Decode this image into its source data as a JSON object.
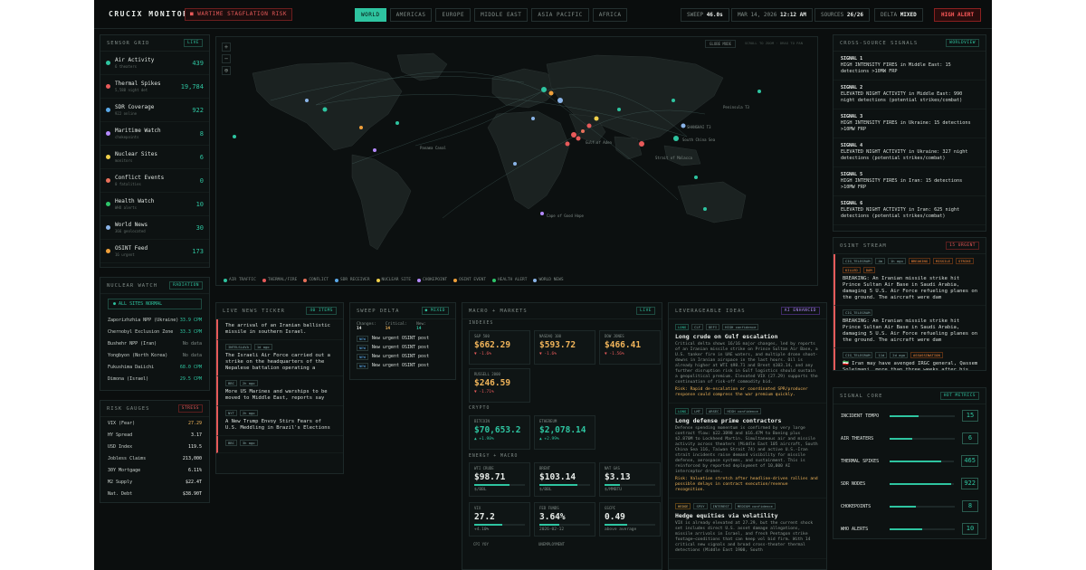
{
  "header": {
    "logo": "CRUCIX MONITOR",
    "alert": "WARTIME STAGFLATION RISK",
    "tabs": [
      "WORLD",
      "AMERICAS",
      "EUROPE",
      "MIDDLE EAST",
      "ASIA PACIFIC",
      "AFRICA"
    ],
    "sweep_label": "SWEEP",
    "sweep_value": "46.0s",
    "date": "MAR 14, 2026",
    "time": "12:12 AM",
    "sources_label": "SOURCES",
    "sources_value": "26/26",
    "delta_label": "DELTA",
    "delta_value": "MIXED",
    "high_alert": "HIGH ALERT"
  },
  "sensor_grid": {
    "title": "SENSOR GRID",
    "badge": "LIVE",
    "items": [
      {
        "name": "Air Activity",
        "sub": "6 theaters",
        "value": "439",
        "color": "#2ec4a0"
      },
      {
        "name": "Thermal Spikes",
        "sub": "5,588 night det",
        "value": "19,784",
        "color": "#e85a5a"
      },
      {
        "name": "SDR Coverage",
        "sub": "922 online",
        "value": "922",
        "color": "#5aa8e8"
      },
      {
        "name": "Maritime Watch",
        "sub": "chokepoints",
        "value": "8",
        "color": "#b58aff"
      },
      {
        "name": "Nuclear Sites",
        "sub": "monitors",
        "value": "6",
        "color": "#f0d04a"
      },
      {
        "name": "Conflict Events",
        "sub": "0 fatalities",
        "value": "0",
        "color": "#e8705a"
      },
      {
        "name": "Health Watch",
        "sub": "WHO alerts",
        "value": "10",
        "color": "#2ec46a"
      },
      {
        "name": "World News",
        "sub": "366 geolocated",
        "value": "30",
        "color": "#8ab4e8"
      },
      {
        "name": "OSINT Feed",
        "sub": "16 urgent",
        "value": "173",
        "color": "#f0a03a"
      }
    ]
  },
  "nuclear_watch": {
    "title": "NUCLEAR WATCH",
    "badge": "RADIATION",
    "status": "ALL SITES NORMAL",
    "rows": [
      {
        "name": "Zaporizhzhia NPP (Ukraine)",
        "value": "33.9 CPM"
      },
      {
        "name": "Chernobyl Exclusion Zone",
        "value": "33.3 CPM"
      },
      {
        "name": "Bushehr NPP (Iran)",
        "value": "No data"
      },
      {
        "name": "Yongbyon (North Korea)",
        "value": "No data"
      },
      {
        "name": "Fukushima Daiichi",
        "value": "68.0 CPM"
      },
      {
        "name": "Dimona (Israel)",
        "value": "29.5 CPM"
      }
    ]
  },
  "risk_gauges": {
    "title": "RISK GAUGES",
    "badge": "STRESS",
    "rows": [
      {
        "name": "VIX (Fear)",
        "value": "27.29"
      },
      {
        "name": "HY Spread",
        "value": "3.17"
      },
      {
        "name": "USD Index",
        "value": "119.5"
      },
      {
        "name": "Jobless Claims",
        "value": "213,000"
      },
      {
        "name": "30Y Mortgage",
        "value": "6.11%"
      },
      {
        "name": "M2 Supply",
        "value": "$22.4T"
      },
      {
        "name": "Nat. Debt",
        "value": "$38.90T"
      }
    ]
  },
  "map": {
    "mode_btn": "GLOBE MODE",
    "hint": "SCROLL TO ZOOM · DRAG TO PAN",
    "labels": [
      "Peninsula T3",
      "SHANGHAI T3",
      "South China Sea",
      "Strait of Malacca",
      "Gulf of Aden",
      "Panama Canal",
      "Cape of Good Hope"
    ],
    "legend": [
      {
        "label": "AIR TRAFFIC",
        "color": "#2ec4a0"
      },
      {
        "label": "THERMAL/FIRE",
        "color": "#e85a5a"
      },
      {
        "label": "CONFLICT",
        "color": "#e8705a"
      },
      {
        "label": "SDR RECEIVER",
        "color": "#5aa8e8"
      },
      {
        "label": "NUCLEAR SITE",
        "color": "#f0d04a"
      },
      {
        "label": "CHOKEPOINT",
        "color": "#b58aff"
      },
      {
        "label": "OSINT EVENT",
        "color": "#f0a03a"
      },
      {
        "label": "HEALTH ALERT",
        "color": "#2ec46a"
      },
      {
        "label": "WORLD NEWS",
        "color": "#8ab4e8"
      }
    ]
  },
  "ticker": {
    "title": "LIVE NEWS TICKER",
    "badge": "40 ITEMS",
    "items": [
      {
        "tags": [],
        "text": "The arrival of an Iranian ballistic missile in southern Israel."
      },
      {
        "tags": [
          "INTELSLAVA",
          "1d ago"
        ],
        "text": "The Israeli Air Force carried out a strike on the headquarters of the Nepalese battalion operating a"
      },
      {
        "tags": [
          "BBC",
          "2h ago"
        ],
        "text": "More US Marines and warships to be moved to Middle East, reports say"
      },
      {
        "tags": [
          "NYT",
          "2h ago"
        ],
        "text": "A New Trump Envoy Stirs Fears of U.S. Meddling in Brazil's Elections"
      },
      {
        "tags": [
          "BBC",
          "3h ago"
        ],
        "text": ""
      }
    ]
  },
  "sweep_delta": {
    "title": "SWEEP DELTA",
    "badge": "MIXED",
    "changes_label": "Changes:",
    "changes": "14",
    "critical_label": "Critical:",
    "critical": "14",
    "new_label": "New:",
    "new": "14",
    "rows": [
      {
        "tag": "NEW",
        "text": "New urgent OSINT post"
      },
      {
        "tag": "NEW",
        "text": "New urgent OSINT post"
      },
      {
        "tag": "NEW",
        "text": "New urgent OSINT post"
      },
      {
        "tag": "NEW",
        "text": "New urgent OSINT post"
      }
    ]
  },
  "macro": {
    "title": "MACRO + MARKETS",
    "badge": "LIVE",
    "indexes_label": "INDEXES",
    "crypto_label": "CRYPTO",
    "energy_label": "ENERGY + MACRO",
    "indexes": [
      {
        "label": "S&P 500",
        "value": "$662.29",
        "delta": "▼ -1.6%"
      },
      {
        "label": "NASDAQ 100",
        "value": "$593.72",
        "delta": "▼ -1.6%"
      },
      {
        "label": "DOW JONES",
        "value": "$466.41",
        "delta": "▼ -1.56%"
      },
      {
        "label": "RUSSELL 2000",
        "value": "$246.59",
        "delta": "▼ -1.71%"
      }
    ],
    "crypto": [
      {
        "label": "BITCOIN",
        "value": "$70,653.2",
        "delta": "▲ +1.98%"
      },
      {
        "label": "ETHEREUM",
        "value": "$2,078.14",
        "delta": "▲ +2.99%"
      }
    ],
    "energy": [
      {
        "label": "WTI CRUDE",
        "value": "$98.71",
        "sub": "$/BBL",
        "fill": 0.7
      },
      {
        "label": "BRENT",
        "value": "$103.14",
        "sub": "$/BBL",
        "fill": 0.75
      },
      {
        "label": "NAT GAS",
        "value": "$3.13",
        "sub": "$/MMBTU",
        "fill": 0.3
      },
      {
        "label": "VIX",
        "value": "27.2",
        "sub": "+4.10%",
        "fill": 0.55
      },
      {
        "label": "FED FUNDS",
        "value": "3.64%",
        "sub": "2026-02-12",
        "fill": 0.4
      },
      {
        "label": "GSCPI",
        "value": "0.49",
        "sub": "above average",
        "fill": 0.45
      }
    ],
    "bottom": [
      "CPI YOY",
      "UNEMPLOYMENT"
    ]
  },
  "ideas": {
    "title": "LEVERAGEABLE IDEAS",
    "badge": "AI ENHANCED",
    "items": [
      {
        "tags": [
          "LONG",
          "CLF",
          "DEFI",
          "HIGH confidence"
        ],
        "title": "Long crude on Gulf escalation",
        "body": "Critical delta shows 16/16 major changes, led by reports of an Iranian missile strike on Prince Sultan Air Base, a U.S. tanker fire in UAE waters, and multiple drone shoot-downs in Iranian airspace in the last hours. Oil is already higher at WTI $98.71 and Brent $103.14, and any further disruption risk in Gulf logistics should sustain a geopolitical premium. Elevated VIX (27.29) supports the continuation of risk-off commodity bid.",
        "risk": "Risk: Rapid de-escalation or coordinated SPR/producer response could compress the war premium quickly."
      },
      {
        "tags": [
          "LONG",
          "LMT",
          "ARSEC",
          "HIGH confidence"
        ],
        "title": "Long defense prime contractors",
        "body": "Defense spending momentum is confirmed by very large contract flow: $22.3B98 and $16.47M to Boeing plus $2.870M to Lockheed Martin. Simultaneous air and missile activity across theaters (Middle East 105 aircraft, South China Sea 116, Taiwan Strait 74) and active U.S.-Iran strait incidents raise demand visibility for missile defense, aerospace systems, and sustainment. This is reinforced by reported deployment of 10,000 AI interceptor drones.",
        "risk": "Risk: Valuation stretch after headline-driven rallies and possible delays in contract execution/revenue recognition."
      },
      {
        "tags": [
          "HEDGE",
          "SPXY",
          "INTEREST",
          "MEDIUM confidence"
        ],
        "title": "Hedge equities via volatility",
        "body": "VIX is already elevated at 27.29, but the current shock set includes direct U.S. asset damage allegations, missile arrivals in Israel, and fresh Pentagon strike footage—conditions that can keep vol bid firm. With 14 critical new signals and broad cross-theater thermal detections (Middle East 1900, South",
        "risk": ""
      }
    ]
  },
  "signals": {
    "title": "CROSS-SOURCE SIGNALS",
    "badge": "WORLDVIEW",
    "items": [
      {
        "label": "SIGNAL 1",
        "text": "HIGH INTENSITY FIRES in Middle East: 15 detections >10MW FRP"
      },
      {
        "label": "SIGNAL 2",
        "text": "ELEVATED NIGHT ACTIVITY in Middle East: 990 night detections (potential strikes/combat)"
      },
      {
        "label": "SIGNAL 3",
        "text": "HIGH INTENSITY FIRES in Ukraine: 15 detections >10MW FRP"
      },
      {
        "label": "SIGNAL 4",
        "text": "ELEVATED NIGHT ACTIVITY in Ukraine: 327 night detections (potential strikes/combat)"
      },
      {
        "label": "SIGNAL 5",
        "text": "HIGH INTENSITY FIRES in Iran: 15 detections >10MW FRP"
      },
      {
        "label": "SIGNAL 6",
        "text": "ELEVATED NIGHT ACTIVITY in Iran: 625 night detections (potential strikes/combat)"
      }
    ]
  },
  "osint": {
    "title": "OSINT STREAM",
    "badge": "15 URGENT",
    "items": [
      {
        "tags": [
          "CIG_TELEGRAM",
          "4m",
          "1h ago",
          "BREAKING",
          "MISSILE",
          "STRIKE",
          "KILLED",
          "DAM"
        ],
        "text": "BREAKING: An Iranian missile strike hit Prince Sultan Air Base in Saudi Arabia, damaging 5 U.S. Air Force refueling planes on the ground. The aircraft were dam"
      },
      {
        "tags": [
          "CIG_TELEGRAM"
        ],
        "text": "BREAKING: An Iranian missile strike hit Prince Sultan Air Base in Saudi Arabia, damaging 5 U.S. Air Force refueling planes on the ground. The aircraft were dam"
      },
      {
        "tags": [
          "CIG_TELEGRAM",
          "11d",
          "2d ago",
          "ASSASSINATION"
        ],
        "text": "🇮🇷 Iran may have avenged IRGC general, Qassem Soleimani, more than three weeks after his assassination..."
      }
    ]
  },
  "signal_core": {
    "title": "SIGNAL CORE",
    "badge": "HOT METRICS",
    "items": [
      {
        "name": "INCIDENT TEMPO",
        "value": "15",
        "fill": 0.45
      },
      {
        "name": "AIR THEATERS",
        "value": "6",
        "fill": 0.35
      },
      {
        "name": "THERMAL SPIKES",
        "value": "465",
        "fill": 0.8
      },
      {
        "name": "SDR NODES",
        "value": "922",
        "fill": 0.95
      },
      {
        "name": "CHOKEPOINTS",
        "value": "8",
        "fill": 0.4
      },
      {
        "name": "WHO ALERTS",
        "value": "10",
        "fill": 0.5
      }
    ]
  }
}
